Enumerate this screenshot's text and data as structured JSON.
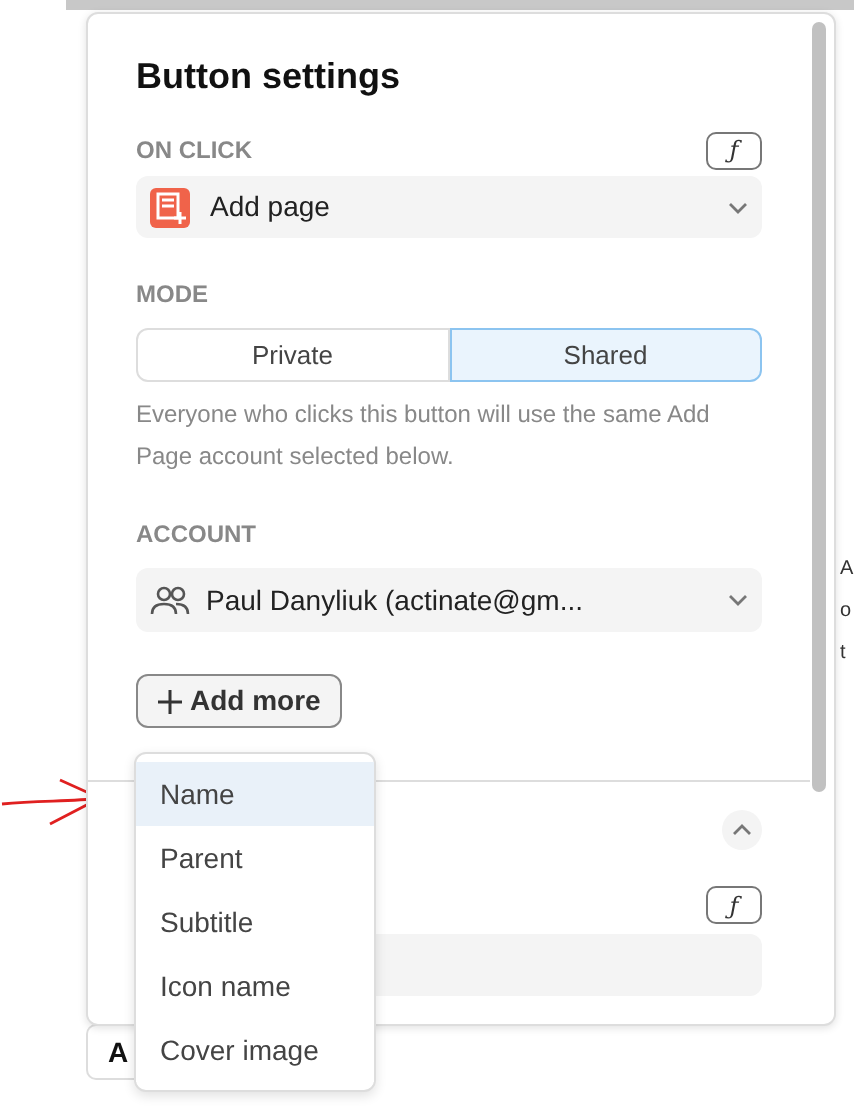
{
  "panel": {
    "title": "Button settings",
    "on_click": {
      "label": "ON CLICK",
      "formula": "ƒ",
      "value": "Add page"
    },
    "mode": {
      "label": "MODE",
      "options": [
        {
          "label": "Private",
          "selected": false
        },
        {
          "label": "Shared",
          "selected": true
        }
      ],
      "hint": "Everyone who clicks this button will use the same Add Page account selected below."
    },
    "account": {
      "label": "ACCOUNT",
      "value": "Paul Danyliuk (actinate@gm..."
    },
    "add_more": "Add more",
    "section": {
      "expanded": true,
      "formula": "ƒ"
    }
  },
  "menu": [
    {
      "label": "Name",
      "selected": true
    },
    {
      "label": "Parent",
      "selected": false
    },
    {
      "label": "Subtitle",
      "selected": false
    },
    {
      "label": "Icon name",
      "selected": false
    },
    {
      "label": "Cover image",
      "selected": false
    }
  ],
  "background": {
    "right_fragments": [
      "A",
      "o",
      "t"
    ],
    "button": "A"
  }
}
